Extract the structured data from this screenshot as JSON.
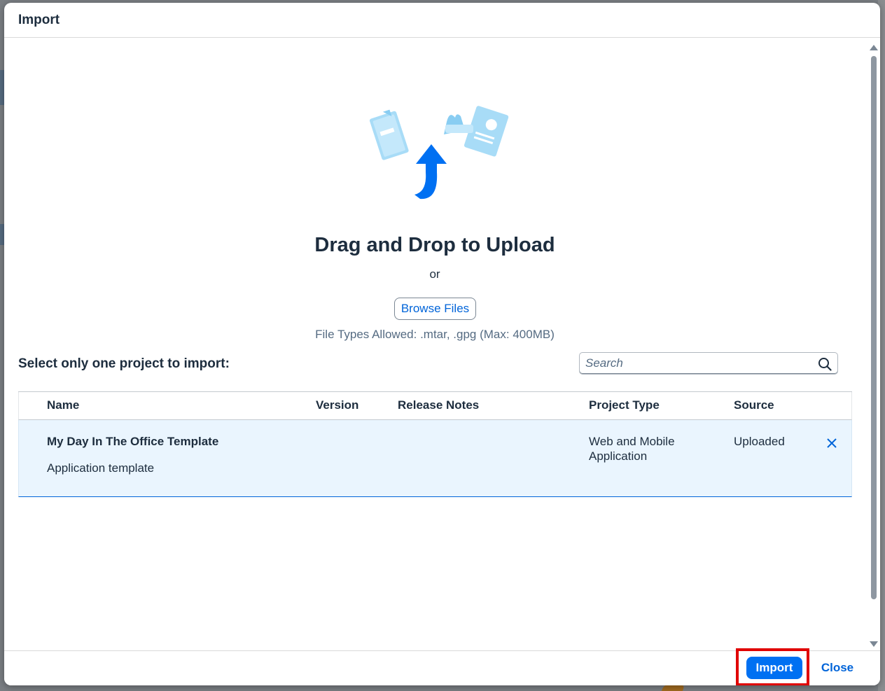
{
  "dialog": {
    "title": "Import"
  },
  "upload": {
    "title": "Drag and Drop to Upload",
    "or": "or",
    "browse_label": "Browse Files",
    "file_types": "File Types Allowed: .mtar, .gpg  (Max: 400MB)"
  },
  "selection": {
    "label": "Select only one project to import:"
  },
  "search": {
    "placeholder": "Search",
    "value": ""
  },
  "table": {
    "columns": [
      "Name",
      "Version",
      "Release Notes",
      "Project Type",
      "Source"
    ],
    "rows": [
      {
        "name": "My Day In The Office Template",
        "description": "Application template",
        "version": "",
        "release_notes": "",
        "project_type": "Web and Mobile Application",
        "source": "Uploaded"
      }
    ]
  },
  "footer": {
    "import_label": "Import",
    "close_label": "Close"
  },
  "colors": {
    "accent": "#0070f2",
    "link": "#0064d9",
    "selected_row": "#eaf5fe",
    "highlight": "#e00000"
  },
  "icons": {
    "illustration": "upload-illustration",
    "search": "search-icon",
    "remove": "close-icon",
    "scroll_up": "arrow-up-icon",
    "scroll_down": "arrow-down-icon"
  }
}
